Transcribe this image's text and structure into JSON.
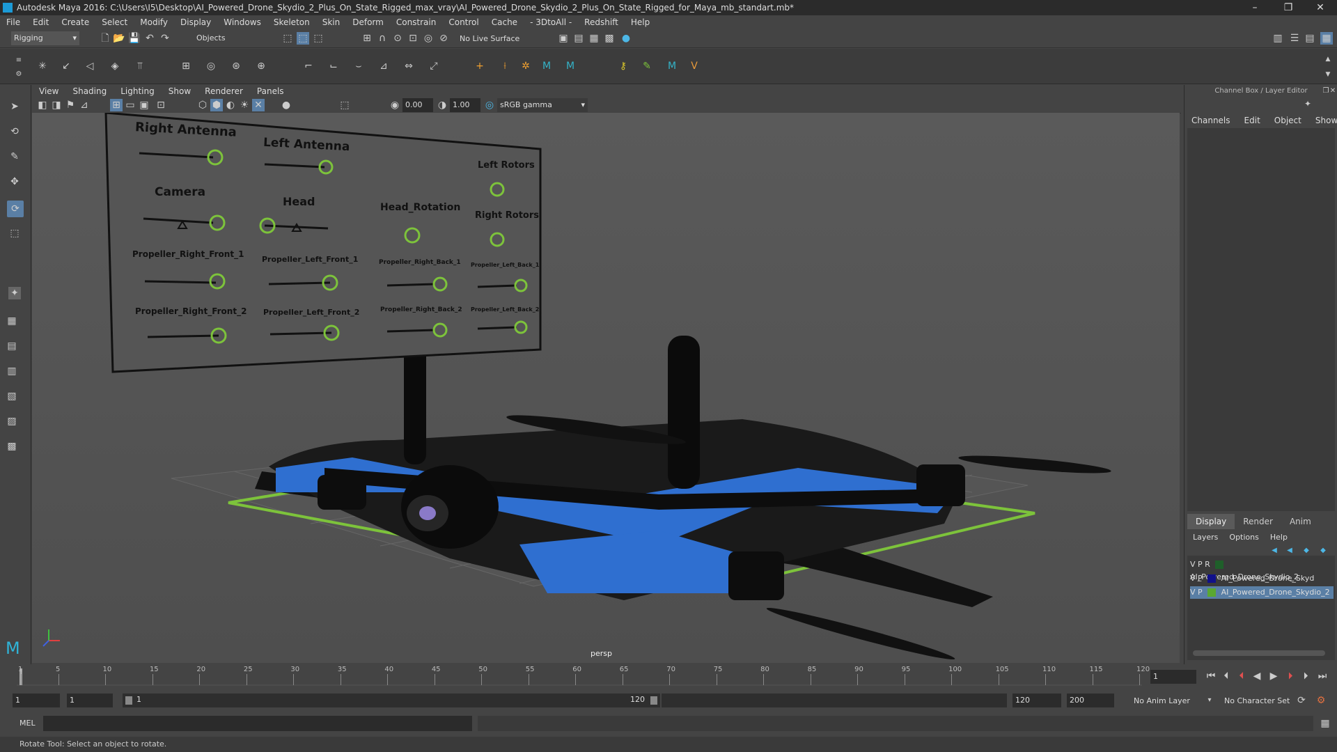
{
  "window": {
    "title": "Autodesk Maya 2016: C:\\Users\\I5\\Desktop\\AI_Powered_Drone_Skydio_2_Plus_On_State_Rigged_max_vray\\AI_Powered_Drone_Skydio_2_Plus_On_State_Rigged_for_Maya_mb_standart.mb*"
  },
  "menus": [
    "File",
    "Edit",
    "Create",
    "Select",
    "Modify",
    "Display",
    "Windows",
    "Skeleton",
    "Skin",
    "Deform",
    "Constrain",
    "Control",
    "Cache",
    "- 3DtoAll -",
    "Redshift",
    "Help"
  ],
  "statusline": {
    "mode": "Rigging",
    "selection_mask": "Objects",
    "live_surface": "No Live Surface"
  },
  "panel_menus": [
    "View",
    "Shading",
    "Lighting",
    "Show",
    "Renderer",
    "Panels"
  ],
  "panel_toolbar": {
    "exposure": "0.00",
    "gamma": "1.00",
    "color_space": "sRGB gamma"
  },
  "viewport": {
    "camera_label": "persp",
    "controls": {
      "right_antenna": "Right Antenna",
      "left_antenna": "Left Antenna",
      "left_rotors": "Left Rotors",
      "camera": "Camera",
      "head": "Head",
      "head_rotation": "Head_Rotation",
      "right_rotors": "Right Rotors",
      "prop_rf1": "Propeller_Right_Front_1",
      "prop_lf1": "Propeller_Left_Front_1",
      "prop_rb1": "Propeller_Right_Back_1",
      "prop_lb1": "Propeller_Left_Back_1",
      "prop_rf2": "Propeller_Right_Front_2",
      "prop_lf2": "Propeller_Left_Front_2",
      "prop_rb2": "Propeller_Right_Back_2",
      "prop_lb2": "Propeller_Left_Back_2"
    }
  },
  "channel_box": {
    "title": "Channel Box / Layer Editor",
    "menus": [
      "Channels",
      "Edit",
      "Object",
      "Show"
    ],
    "tabs": [
      "Display",
      "Render",
      "Anim"
    ],
    "layer_menus": [
      "Layers",
      "Options",
      "Help"
    ],
    "layers": [
      {
        "flags": "V P R",
        "name": "AI_Powered_Drone_Skydio_2",
        "color": "#1f5f2a"
      },
      {
        "flags": "V   P",
        "name": "AI_Powered_Drone_Skyd",
        "color": "#11118a"
      },
      {
        "flags": "V P",
        "name": "AI_Powered_Drone_Skydio_2",
        "color": "#5aa832"
      }
    ]
  },
  "timeline": {
    "ticks": [
      "1",
      "5",
      "10",
      "15",
      "20",
      "25",
      "30",
      "35",
      "40",
      "45",
      "50",
      "55",
      "60",
      "65",
      "70",
      "75",
      "80",
      "85",
      "90",
      "95",
      "100",
      "105",
      "110",
      "115",
      "120"
    ],
    "current_frame": "1",
    "range_start": "1",
    "playback_start": "1",
    "range_slider_start": "1",
    "range_slider_end": "120",
    "playback_end": "120",
    "anim_end": "200",
    "anim_layer": "No Anim Layer",
    "character_set": "No Character Set"
  },
  "command_line": {
    "language": "MEL"
  },
  "help_line": "Rotate Tool: Select an object to rotate.",
  "colors": {
    "drone_blue": "#2f6fd0",
    "control_green": "#7dc33b",
    "bg": "#444444"
  }
}
